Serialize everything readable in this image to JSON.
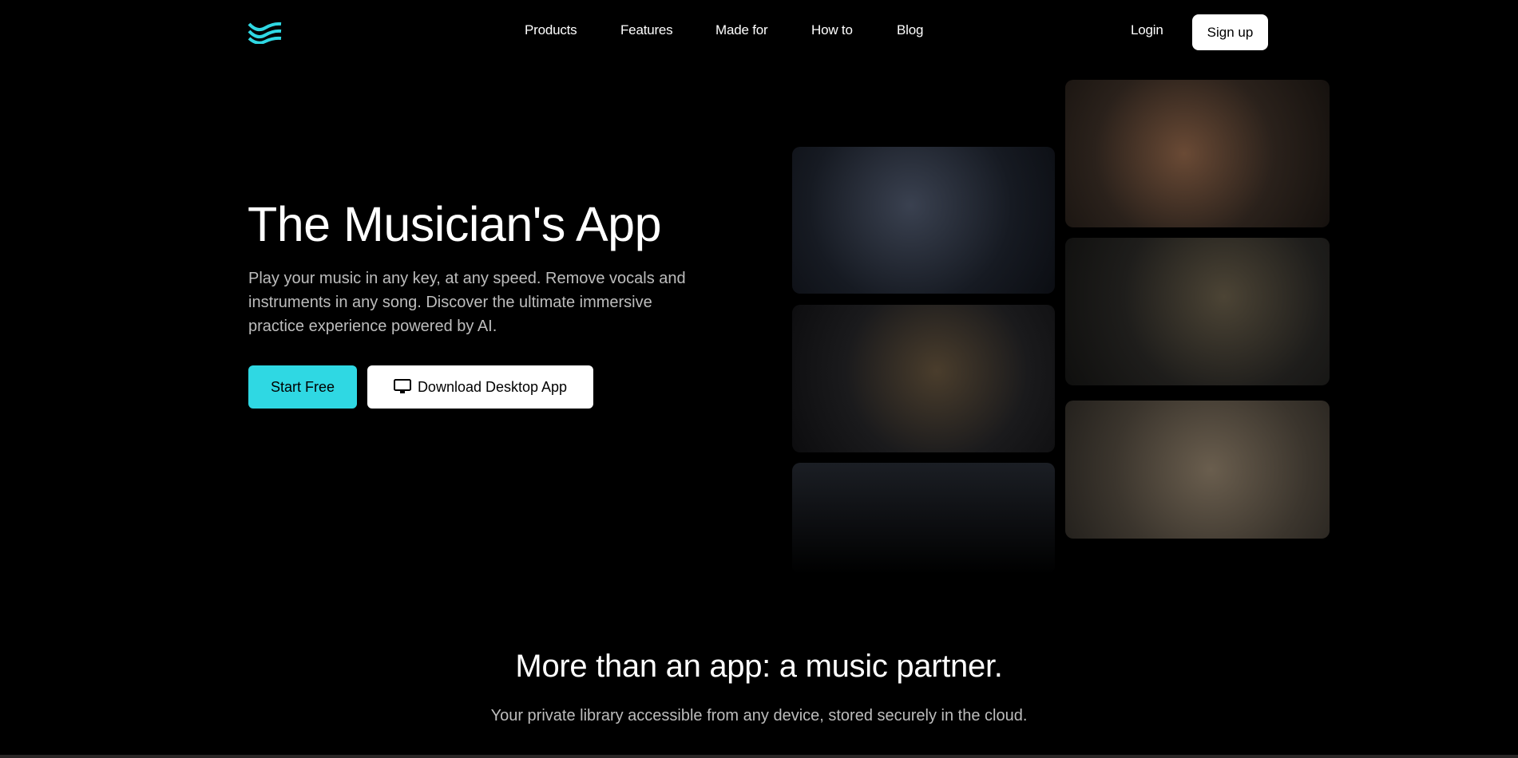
{
  "header": {
    "logo": "Moises logo",
    "nav": [
      "Products",
      "Features",
      "Made for",
      "How to",
      "Blog"
    ],
    "login": "Login",
    "signup": "Sign up"
  },
  "hero": {
    "title": "The Musician's App",
    "description": "Play your music in any key, at any speed. Remove vocals and instruments in any song. Discover the ultimate immersive practice experience powered by AI.",
    "start_free": "Start Free",
    "download": "Download Desktop App",
    "download_icon": "monitor-icon"
  },
  "section": {
    "title": "More than an app: a music partner.",
    "subtitle": "Your private library accessible from any device, stored securely in the cloud."
  },
  "colors": {
    "accent": "#2fd8e3",
    "background": "#000000"
  }
}
